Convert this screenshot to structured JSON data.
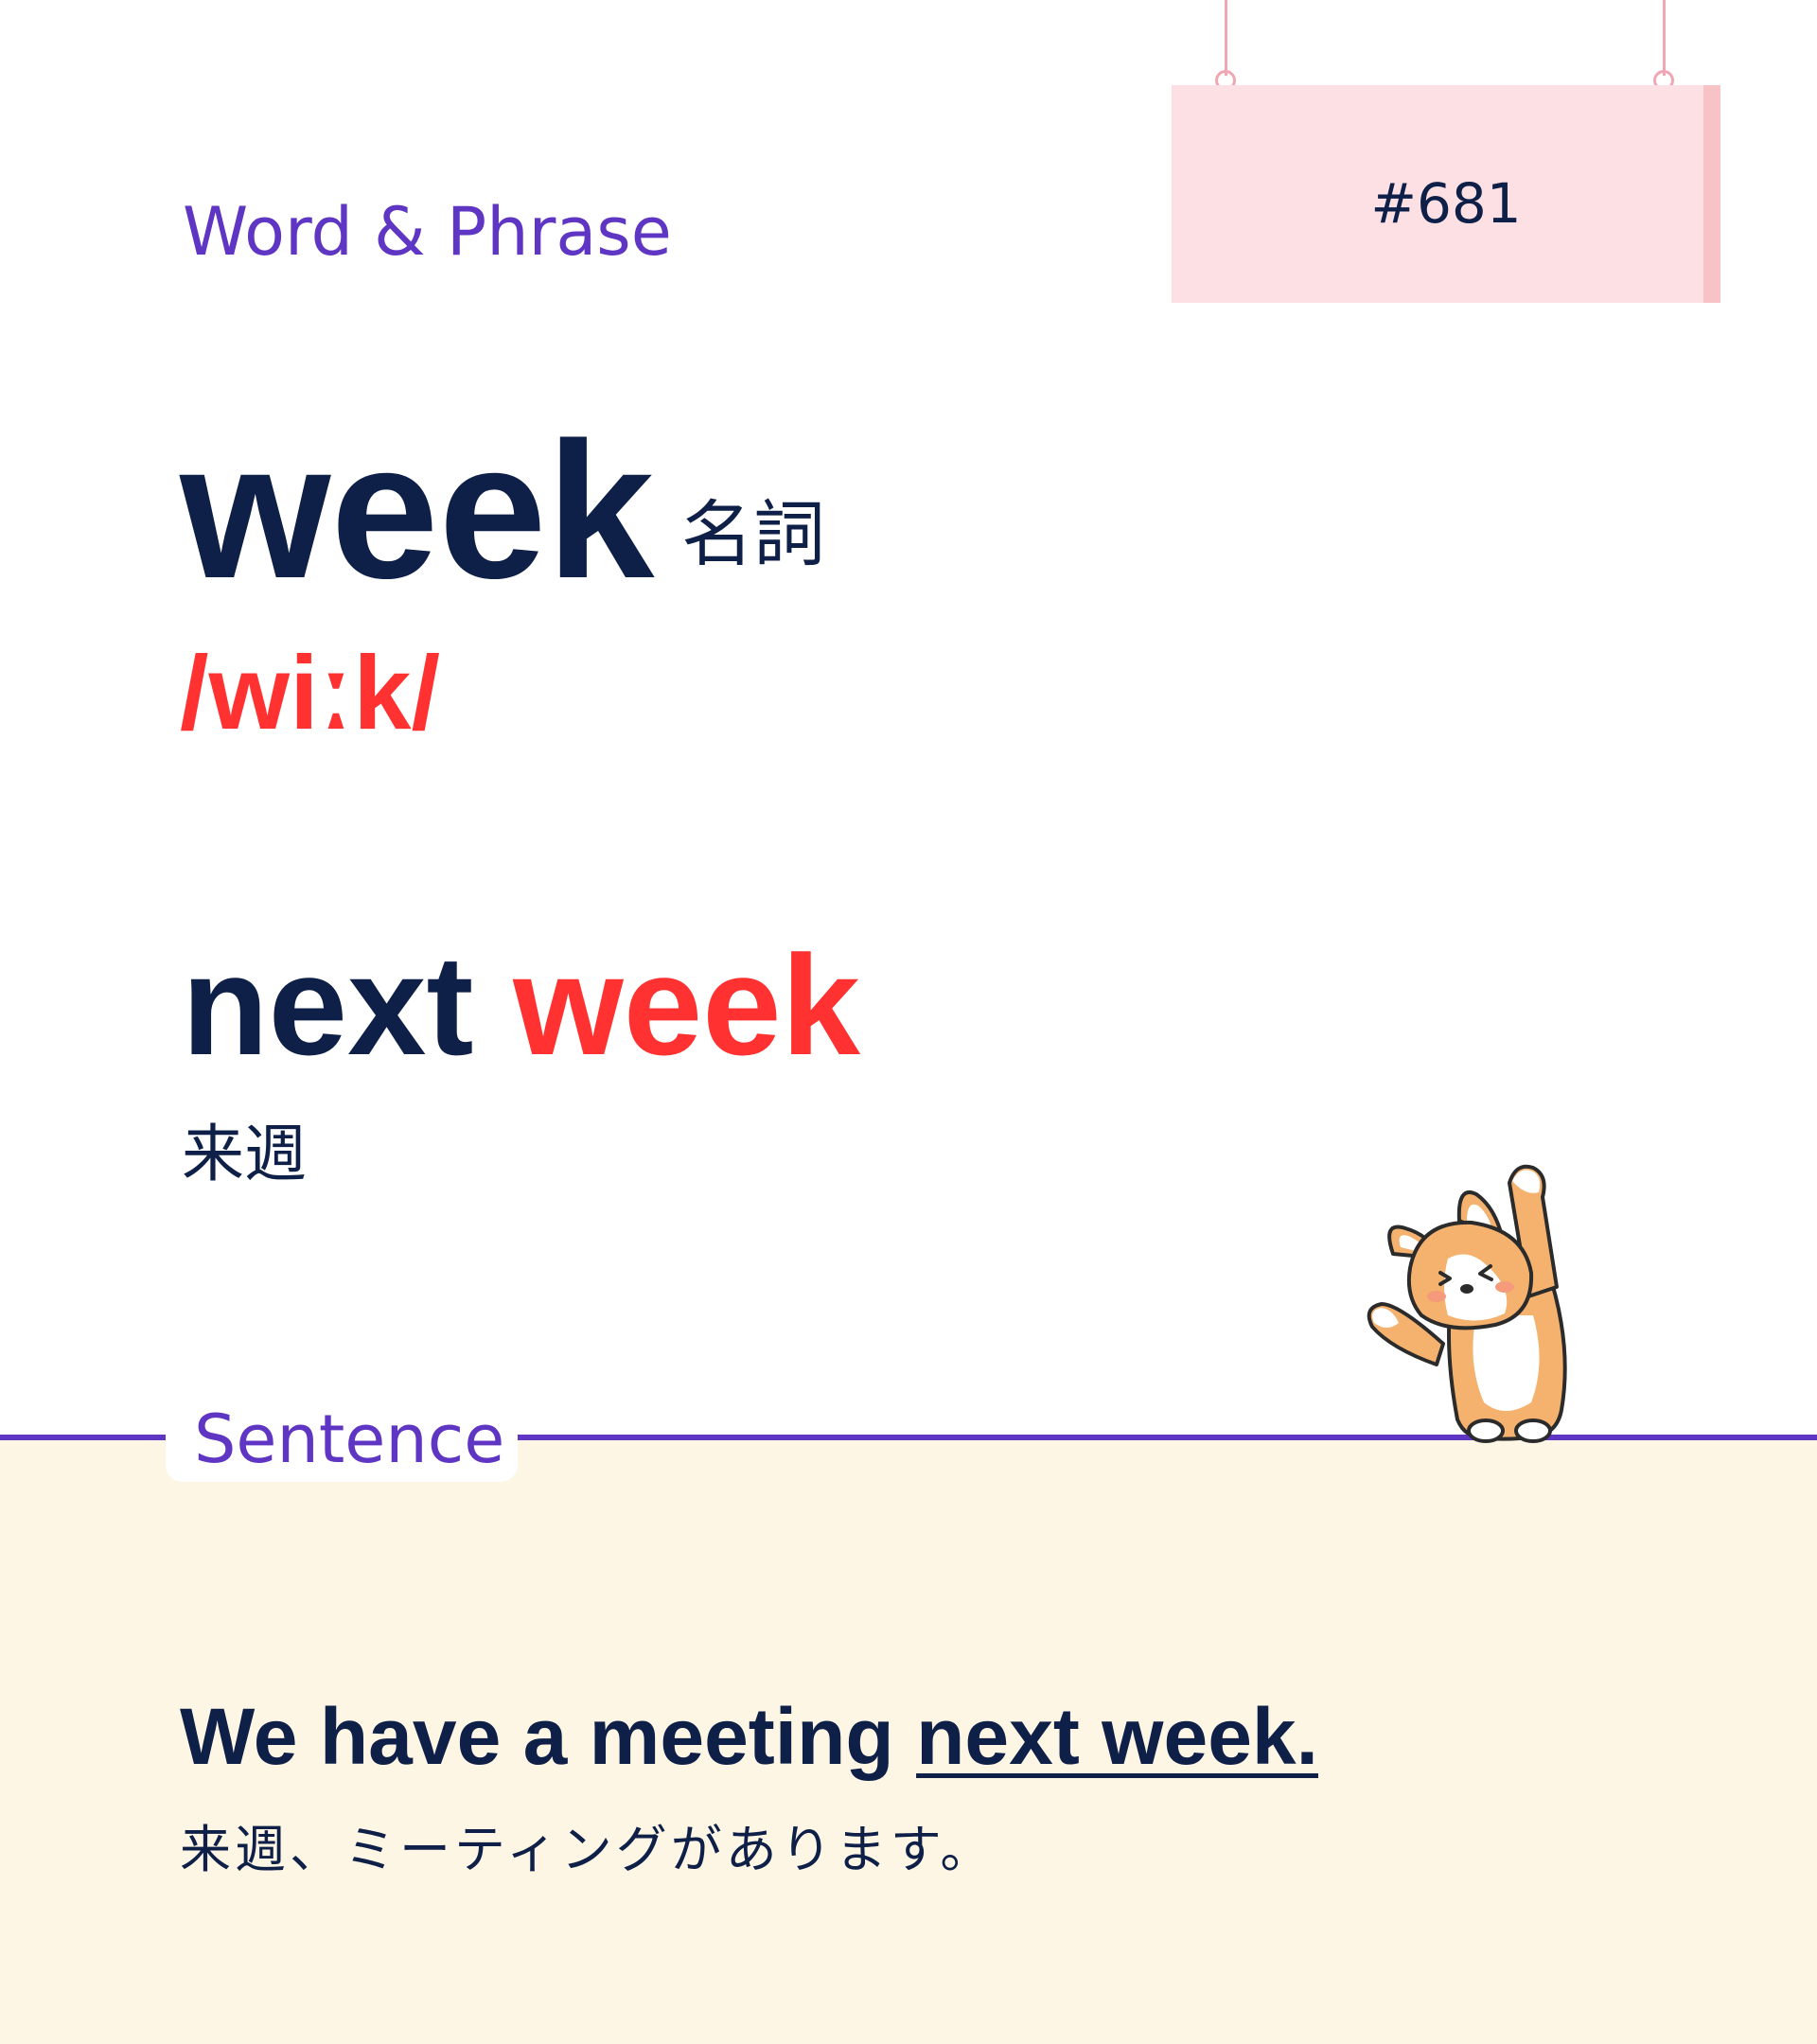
{
  "card": {
    "category": "Word & Phrase",
    "number": "#681"
  },
  "word": {
    "headword": "week",
    "part_of_speech": "名詞",
    "pronunciation": "/wiːk/"
  },
  "phrase": {
    "before": "next ",
    "highlight": "week",
    "translation": "来週"
  },
  "sentence": {
    "section_label": "Sentence",
    "before": "We have a meeting ",
    "underlined": "next week.",
    "translation": "来週、ミーティングがあります。"
  },
  "colors": {
    "navy": "#0e1f48",
    "red": "#ff3131",
    "purple": "#5f35c3",
    "sign_pink": "#fde0e3",
    "cream": "#fdf6e4"
  },
  "icons": {
    "mascot": "corgi-mascot-icon"
  }
}
